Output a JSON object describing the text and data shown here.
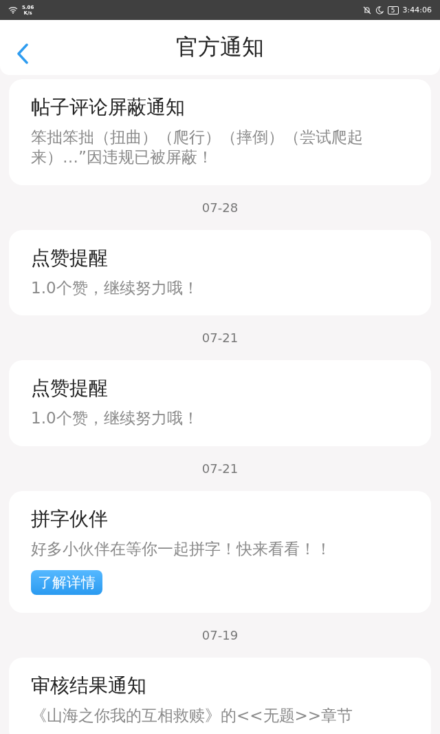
{
  "status_bar": {
    "speed": "5.06",
    "speed_unit": "K/s",
    "battery": "5",
    "time": "3:44:06"
  },
  "header": {
    "title": "官方通知"
  },
  "feed": [
    {
      "kind": "card",
      "title": "帖子评论屏蔽通知",
      "body": "笨拙笨拙（扭曲）（爬行）（摔倒）（尝试爬起来）…”因违规已被屏蔽！"
    },
    {
      "kind": "date",
      "text": "07-28"
    },
    {
      "kind": "card",
      "title": "点赞提醒",
      "body": "1.0个赞，继续努力哦！"
    },
    {
      "kind": "date",
      "text": "07-21"
    },
    {
      "kind": "card",
      "title": "点赞提醒",
      "body": "1.0个赞，继续努力哦！"
    },
    {
      "kind": "date",
      "text": "07-21"
    },
    {
      "kind": "card",
      "title": "拼字伙伴",
      "body": "好多小伙伴在等你一起拼字！快来看看！！",
      "button": "了解详情"
    },
    {
      "kind": "date",
      "text": "07-19"
    },
    {
      "kind": "card",
      "title": "审核结果通知",
      "body": "《山海之你我的互相救赎》的<<无题>>章节"
    }
  ]
}
